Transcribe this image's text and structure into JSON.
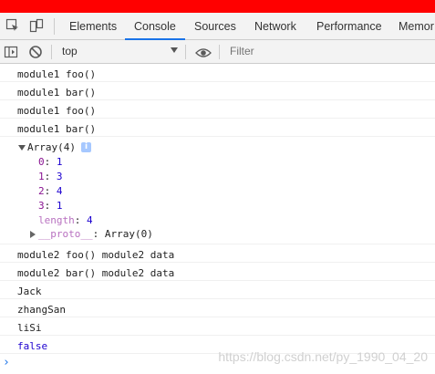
{
  "devtools": {
    "tabs": [
      "Elements",
      "Console",
      "Sources",
      "Network",
      "Performance",
      "Memor"
    ],
    "active_tab": "Console"
  },
  "toolbar": {
    "context": "top",
    "filter_placeholder": "Filter"
  },
  "console": {
    "logs_top": [
      "module1 foo()",
      "module1 bar()",
      "module1 foo()",
      "module1 bar()"
    ],
    "array": {
      "summary": "Array(4)",
      "items": [
        {
          "key": "0",
          "value": "1"
        },
        {
          "key": "1",
          "value": "3"
        },
        {
          "key": "2",
          "value": "4"
        },
        {
          "key": "3",
          "value": "1"
        }
      ],
      "length_key": "length",
      "length_value": "4",
      "proto_key": "__proto__",
      "proto_value": "Array(0)"
    },
    "logs_bottom": [
      "module2 foo() module2 data",
      "module2 bar() module2 data",
      "Jack",
      "zhangSan",
      "liSi"
    ],
    "boolean_result": "false"
  },
  "watermark": "https://blog.csdn.net/py_1990_04_20",
  "colors": {
    "top_bar": "#ff0000",
    "accent": "#1a73e8",
    "object_key": "#881391",
    "number": "#1c00cf"
  }
}
